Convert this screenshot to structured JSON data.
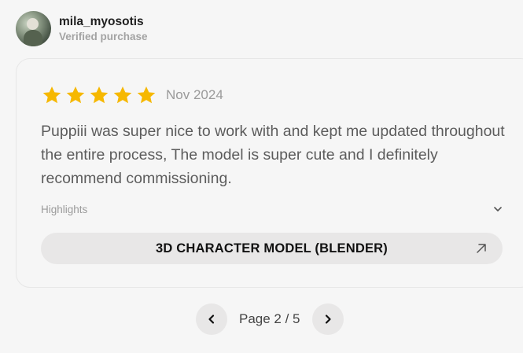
{
  "reviewer": {
    "username": "mila_myosotis",
    "status": "Verified purchase"
  },
  "review": {
    "rating": 5,
    "rating_max": 5,
    "star_color": "#f6b800",
    "date": "Nov 2024",
    "text": "Puppiii was super nice to work with and kept me updated throughout the entire process, The model is super cute and I definitely recommend commissioning.",
    "highlights_label": "Highlights",
    "service_label": "3D CHARACTER MODEL (BLENDER)"
  },
  "pagination": {
    "label": "Page 2 / 5"
  },
  "icons": {
    "star": "star-icon",
    "expand": "chevron-down-icon",
    "external": "arrow-up-right-icon",
    "prev": "chevron-left-icon",
    "next": "chevron-right-icon"
  }
}
